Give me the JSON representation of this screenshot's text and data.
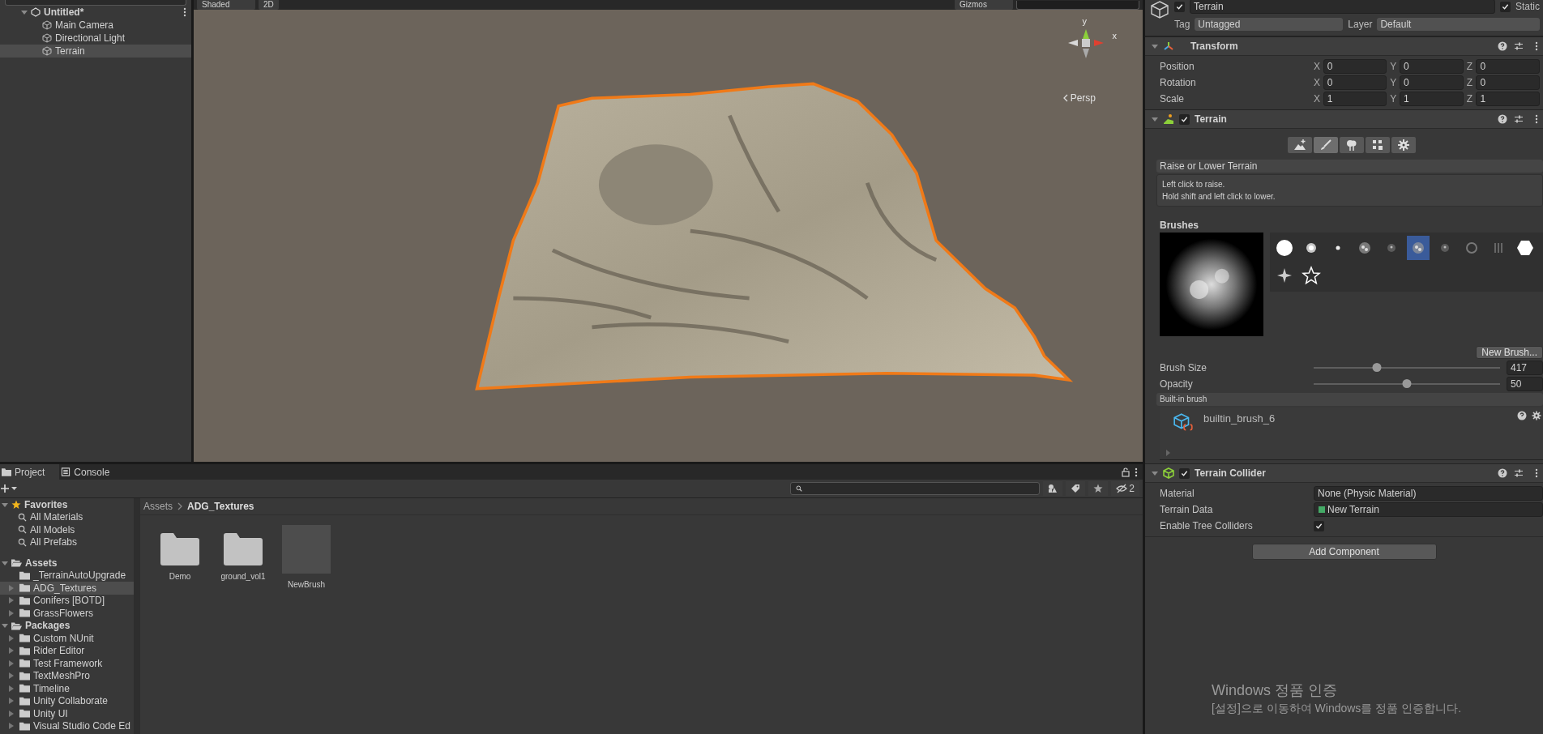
{
  "hierarchy": {
    "scene": "Untitled*",
    "items": [
      {
        "label": "Main Camera",
        "selected": false
      },
      {
        "label": "Directional Light",
        "selected": false
      },
      {
        "label": "Terrain",
        "selected": true
      }
    ]
  },
  "scene_toolbar": {
    "shading": "Shaded",
    "mode": "2D",
    "gizmos": "Gizmos"
  },
  "scene_view": {
    "axis_y": "y",
    "axis_x": "x",
    "projection": "Persp"
  },
  "project": {
    "tabs": [
      {
        "label": "Project",
        "selected": true
      },
      {
        "label": "Console",
        "selected": false
      }
    ],
    "hidden_count": "2",
    "favorites": {
      "label": "Favorites",
      "items": [
        "All Materials",
        "All Models",
        "All Prefabs"
      ]
    },
    "roots": [
      {
        "label": "Assets",
        "children": [
          {
            "label": "_TerrainAutoUpgrade",
            "expandable": false,
            "selected": false
          },
          {
            "label": "ADG_Textures",
            "expandable": true,
            "selected": true
          },
          {
            "label": "Conifers [BOTD]",
            "expandable": true,
            "selected": false
          },
          {
            "label": "GrassFlowers",
            "expandable": true,
            "selected": false
          }
        ]
      },
      {
        "label": "Packages",
        "children": [
          {
            "label": "Custom NUnit",
            "expandable": true,
            "selected": false
          },
          {
            "label": "Rider Editor",
            "expandable": true,
            "selected": false
          },
          {
            "label": "Test Framework",
            "expandable": true,
            "selected": false
          },
          {
            "label": "TextMeshPro",
            "expandable": true,
            "selected": false
          },
          {
            "label": "Timeline",
            "expandable": true,
            "selected": false
          },
          {
            "label": "Unity Collaborate",
            "expandable": true,
            "selected": false
          },
          {
            "label": "Unity UI",
            "expandable": true,
            "selected": false
          },
          {
            "label": "Visual Studio Code Ed",
            "expandable": true,
            "selected": false
          }
        ]
      }
    ],
    "breadcrumb": [
      "Assets",
      "ADG_Textures"
    ],
    "items": [
      {
        "name": "Demo",
        "kind": "folder"
      },
      {
        "name": "ground_vol1",
        "kind": "folder"
      },
      {
        "name": "NewBrush",
        "kind": "asset"
      }
    ]
  },
  "inspector": {
    "name": "Terrain",
    "active": true,
    "static_label": "Static",
    "static": true,
    "tag_label": "Tag",
    "tag": "Untagged",
    "layer_label": "Layer",
    "layer": "Default",
    "transform": {
      "title": "Transform",
      "rows": [
        {
          "label": "Position",
          "values": [
            {
              "axis": "X",
              "value": "0"
            },
            {
              "axis": "Y",
              "value": "0"
            },
            {
              "axis": "Z",
              "value": "0"
            }
          ]
        },
        {
          "label": "Rotation",
          "values": [
            {
              "axis": "X",
              "value": "0"
            },
            {
              "axis": "Y",
              "value": "0"
            },
            {
              "axis": "Z",
              "value": "0"
            }
          ]
        },
        {
          "label": "Scale",
          "values": [
            {
              "axis": "X",
              "value": "1"
            },
            {
              "axis": "Y",
              "value": "1"
            },
            {
              "axis": "Z",
              "value": "1"
            }
          ]
        }
      ]
    },
    "terrain": {
      "title": "Terrain",
      "enabled": true,
      "tools": [
        {
          "kind": "neighbor",
          "selected": false
        },
        {
          "kind": "paint",
          "selected": true
        },
        {
          "kind": "trees",
          "selected": false
        },
        {
          "kind": "details",
          "selected": false
        },
        {
          "kind": "settings",
          "selected": false
        }
      ],
      "mode": "Raise or Lower Terrain",
      "help": [
        "Left click to raise.",
        "Hold shift and left click to lower."
      ],
      "brushes_label": "Brushes",
      "brushes": [
        {
          "kind": "hard-circle",
          "selected": false
        },
        {
          "kind": "soft-circle",
          "selected": false
        },
        {
          "kind": "dot",
          "selected": false
        },
        {
          "kind": "noise",
          "selected": false
        },
        {
          "kind": "speckle",
          "selected": false
        },
        {
          "kind": "noise",
          "selected": true
        },
        {
          "kind": "speckle",
          "selected": false
        },
        {
          "kind": "ring",
          "selected": false
        },
        {
          "kind": "streaks",
          "selected": false
        },
        {
          "kind": "hexagon",
          "selected": false
        },
        {
          "kind": "star-soft",
          "selected": false
        },
        {
          "kind": "star-outline",
          "selected": false
        }
      ],
      "new_brush": "New Brush...",
      "sliders": [
        {
          "label": "Brush Size",
          "level": 0.34,
          "value": "417"
        },
        {
          "label": "Opacity",
          "level": 0.5,
          "value": "50"
        }
      ],
      "brush_type": "Built-in brush",
      "brush_asset": "builtin_brush_6"
    },
    "collider": {
      "title": "Terrain Collider",
      "enabled": true,
      "material_label": "Material",
      "material": "None (Physic Material)",
      "data_label": "Terrain Data",
      "data": "New Terrain",
      "trees_label": "Enable Tree Colliders",
      "trees": true
    },
    "add_component": "Add Component"
  },
  "os_notice": {
    "title": "Windows 정품 인증",
    "body": "[설정]으로 이동하여 Windows를 정품 인증합니다."
  }
}
